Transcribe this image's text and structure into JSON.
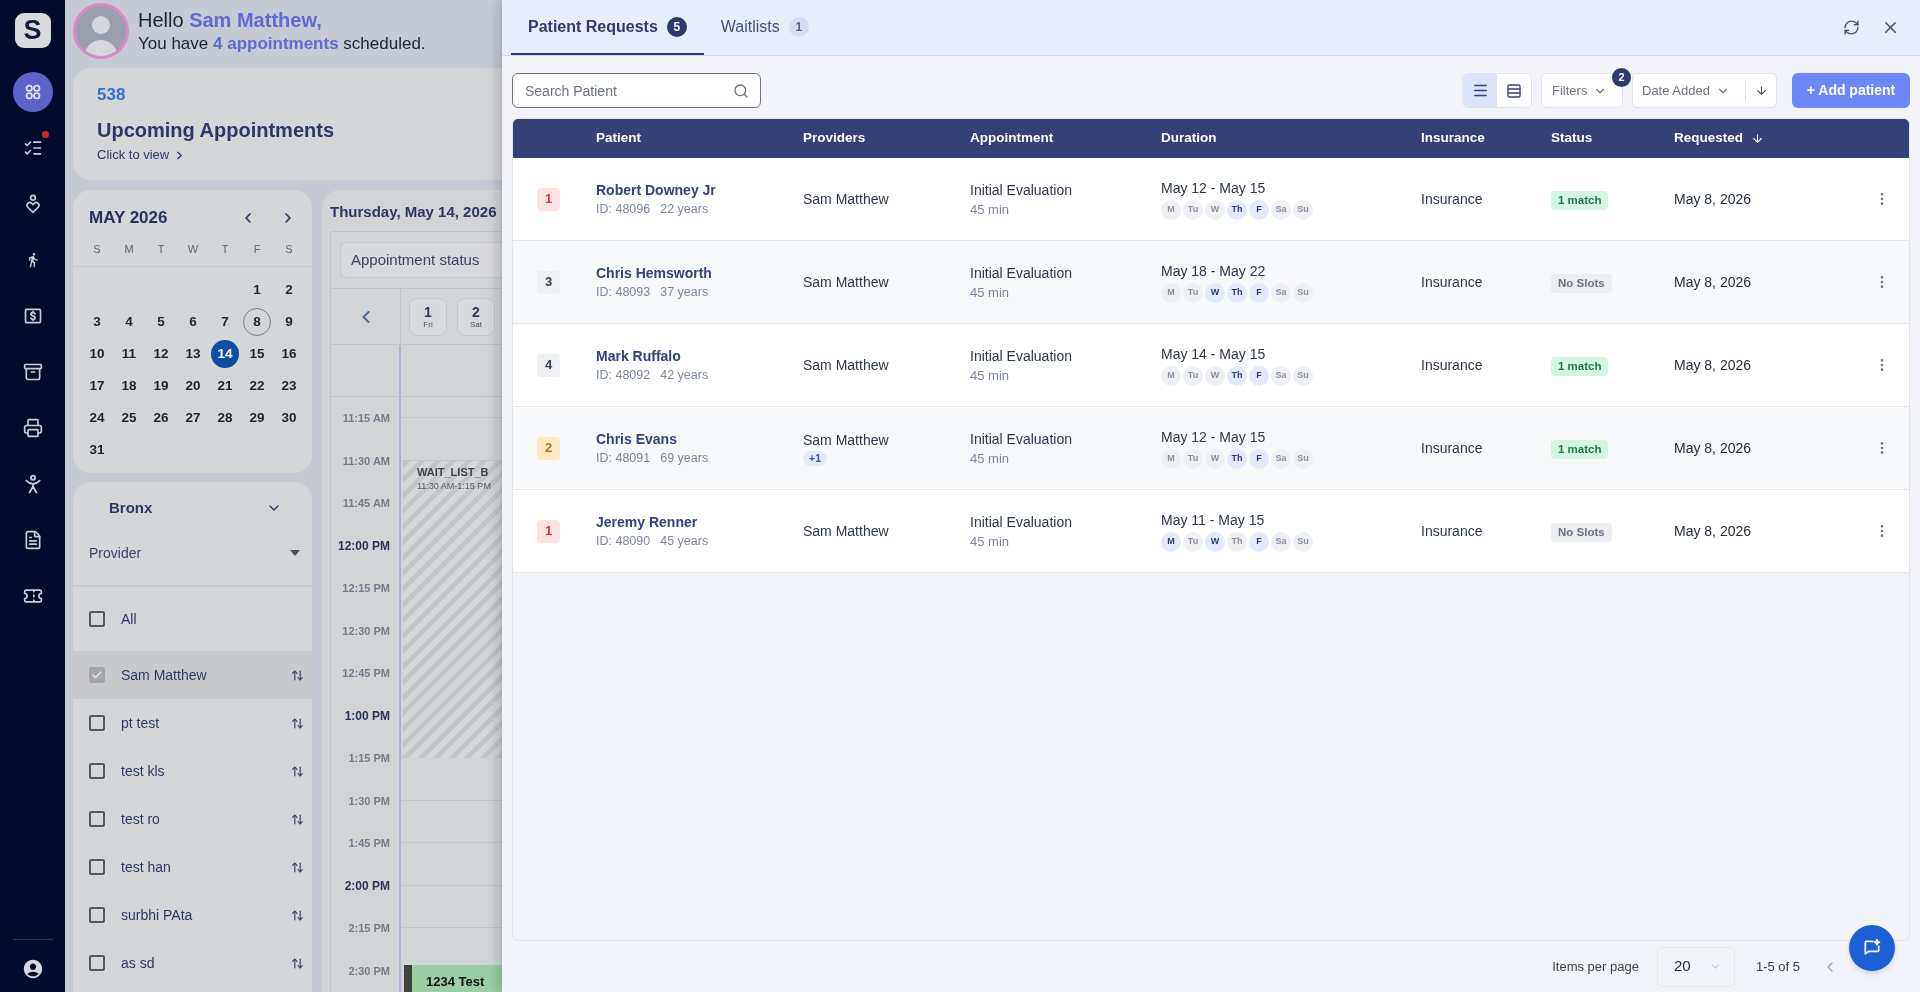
{
  "nav": {
    "logo": "S",
    "items": [
      {
        "selected": true,
        "alert": false
      },
      {
        "selected": false,
        "alert": true
      },
      {
        "selected": false,
        "alert": false
      },
      {
        "selected": false,
        "alert": false
      },
      {
        "selected": false,
        "alert": false
      },
      {
        "selected": false,
        "alert": false
      },
      {
        "selected": false,
        "alert": false
      },
      {
        "selected": false,
        "alert": false
      },
      {
        "selected": false,
        "alert": false
      },
      {
        "selected": false,
        "alert": false
      }
    ]
  },
  "greeting": {
    "line_1": "Hello **Sam Matthew,**",
    "line_2": "You have **4 appointments** scheduled."
  },
  "summary_card": {
    "count": "538",
    "title": "Upcoming Appointments",
    "link": "Click to view"
  },
  "mini_calendar": {
    "title": "MAY 2026",
    "weekdays": [
      "S",
      "M",
      "T",
      "W",
      "T",
      "F",
      "S"
    ],
    "weeks": [
      [
        {
          "label": "1",
          "selected": false,
          "today": false
        },
        {
          "label": "2",
          "selected": false,
          "today": false
        }
      ],
      [
        {
          "label": "3",
          "selected": false,
          "today": false
        },
        {
          "label": "4",
          "selected": false,
          "today": false
        },
        {
          "label": "5",
          "selected": false,
          "today": false
        },
        {
          "label": "6",
          "selected": false,
          "today": false
        },
        {
          "label": "7",
          "selected": false,
          "today": false
        },
        {
          "label": "8",
          "selected": false,
          "today": true
        },
        {
          "label": "9",
          "selected": false,
          "today": false
        }
      ],
      [
        {
          "label": "10",
          "selected": false,
          "today": false
        },
        {
          "label": "11",
          "selected": false,
          "today": false
        },
        {
          "label": "12",
          "selected": false,
          "today": false
        },
        {
          "label": "13",
          "selected": false,
          "today": false
        },
        {
          "label": "14",
          "selected": true,
          "today": false
        },
        {
          "label": "15",
          "selected": false,
          "today": false
        },
        {
          "label": "16",
          "selected": false,
          "today": false
        }
      ],
      [
        {
          "label": "17",
          "selected": false,
          "today": false
        },
        {
          "label": "18",
          "selected": false,
          "today": false
        },
        {
          "label": "19",
          "selected": false,
          "today": false
        },
        {
          "label": "20",
          "selected": false,
          "today": false
        },
        {
          "label": "21",
          "selected": false,
          "today": false
        },
        {
          "label": "22",
          "selected": false,
          "today": false
        },
        {
          "label": "23",
          "selected": false,
          "today": false
        }
      ],
      [
        {
          "label": "24",
          "selected": false,
          "today": false
        },
        {
          "label": "25",
          "selected": false,
          "today": false
        },
        {
          "label": "26",
          "selected": false,
          "today": false
        },
        {
          "label": "27",
          "selected": false,
          "today": false
        },
        {
          "label": "28",
          "selected": false,
          "today": false
        },
        {
          "label": "29",
          "selected": false,
          "today": false
        },
        {
          "label": "30",
          "selected": false,
          "today": false
        }
      ],
      [
        {
          "label": "31",
          "selected": false,
          "today": false
        }
      ]
    ]
  },
  "schedule": {
    "date_title": "Thursday, May 14, 2026",
    "status_filter": "Appointment status",
    "day_strip": [
      {
        "day": "1",
        "weekday": "Fri"
      },
      {
        "day": "2",
        "weekday": "Sat"
      }
    ],
    "times": [
      {
        "label": "11:15 AM",
        "kind": "quarter"
      },
      {
        "label": "11:30 AM",
        "kind": "quarter"
      },
      {
        "label": "11:45 AM",
        "kind": "quarter"
      },
      {
        "label": "12:00 PM",
        "kind": "hour"
      },
      {
        "label": "12:15 PM",
        "kind": "quarter"
      },
      {
        "label": "12:30 PM",
        "kind": "quarter"
      },
      {
        "label": "12:45 PM",
        "kind": "quarter"
      },
      {
        "label": "1:00 PM",
        "kind": "hour"
      },
      {
        "label": "1:15 PM",
        "kind": "quarter"
      },
      {
        "label": "1:30 PM",
        "kind": "quarter"
      },
      {
        "label": "1:45 PM",
        "kind": "quarter"
      },
      {
        "label": "2:00 PM",
        "kind": "hour"
      },
      {
        "label": "2:15 PM",
        "kind": "quarter"
      },
      {
        "label": "2:30 PM",
        "kind": "quarter"
      }
    ],
    "events": [
      {
        "kind": "blocked",
        "title": "WAIT_LIST_B",
        "time": "11:30 AM-1:15 PM"
      },
      {
        "kind": "appointment",
        "title": "1234 Test"
      }
    ]
  },
  "providers": {
    "location": "Bronx",
    "filter": "Provider",
    "items": [
      {
        "kind": "all",
        "name": "All",
        "checked": false,
        "selected": false
      },
      {
        "kind": "provider",
        "name": "Sam Matthew",
        "checked": true,
        "selected": true
      },
      {
        "kind": "provider",
        "name": "pt test",
        "checked": false,
        "selected": false
      },
      {
        "kind": "provider",
        "name": "test kls",
        "checked": false,
        "selected": false
      },
      {
        "kind": "provider",
        "name": "test ro",
        "checked": false,
        "selected": false
      },
      {
        "kind": "provider",
        "name": "test han",
        "checked": false,
        "selected": false
      },
      {
        "kind": "provider",
        "name": "surbhi PAta",
        "checked": false,
        "selected": false
      },
      {
        "kind": "provider",
        "name": "as sd",
        "checked": false,
        "selected": false
      }
    ]
  },
  "panel": {
    "tabs": [
      {
        "label": "Patient Requests",
        "count": "5",
        "selected": true
      },
      {
        "label": "Waitlists",
        "count": "1",
        "selected": false
      }
    ],
    "search": {
      "placeholder": "Search Patient"
    },
    "view_modes": [
      {
        "selected": true
      },
      {
        "selected": false
      }
    ],
    "filters": {
      "label": "Filters",
      "count": "2"
    },
    "sort": {
      "label": "Date Added"
    },
    "add_button": "+ Add patient",
    "table": {
      "columns": [
        {
          "label": "Patient",
          "sorted": false
        },
        {
          "label": "Providers",
          "sorted": false
        },
        {
          "label": "Appointment",
          "sorted": false
        },
        {
          "label": "Duration",
          "sorted": false
        },
        {
          "label": "Insurance",
          "sorted": false
        },
        {
          "label": "Status",
          "sorted": false
        },
        {
          "label": "Requested",
          "sorted": true
        }
      ],
      "rows": [
        {
          "priority": {
            "label": "1",
            "color": "#fde2e2"
          },
          "name": "Robert Downey Jr",
          "id": "ID: 48096",
          "age": "22 years",
          "provider": "Sam Matthew",
          "appointment": "Initial Evaluation",
          "length": "45 min",
          "range": "May 12 - May 15",
          "days": [
            {
              "label": "M",
              "selected": false
            },
            {
              "label": "Tu",
              "selected": false
            },
            {
              "label": "W",
              "selected": false
            },
            {
              "label": "Th",
              "selected": true
            },
            {
              "label": "F",
              "selected": true
            },
            {
              "label": "Sa",
              "selected": false
            },
            {
              "label": "Su",
              "selected": false
            }
          ],
          "insurance": "Insurance",
          "status": {
            "label": "1 match",
            "color": "#d5f5e3"
          },
          "requested": "May 8, 2026"
        },
        {
          "priority": {
            "label": "3",
            "color": "#eef0f4"
          },
          "name": "Chris Hemsworth",
          "id": "ID: 48093",
          "age": "37 years",
          "provider": "Sam Matthew",
          "appointment": "Initial Evaluation",
          "length": "45 min",
          "range": "May 18 - May 22",
          "days": [
            {
              "label": "M",
              "selected": false
            },
            {
              "label": "Tu",
              "selected": false
            },
            {
              "label": "W",
              "selected": true
            },
            {
              "label": "Th",
              "selected": true
            },
            {
              "label": "F",
              "selected": true
            },
            {
              "label": "Sa",
              "selected": false
            },
            {
              "label": "Su",
              "selected": false
            }
          ],
          "insurance": "Insurance",
          "status": {
            "label": "No Slots",
            "color": "#eceef2"
          },
          "requested": "May 8, 2026"
        },
        {
          "priority": {
            "label": "4",
            "color": "#eef0f4"
          },
          "name": "Mark Ruffalo",
          "id": "ID: 48092",
          "age": "42 years",
          "provider": "Sam Matthew",
          "appointment": "Initial Evaluation",
          "length": "45 min",
          "range": "May 14 - May 15",
          "days": [
            {
              "label": "M",
              "selected": false
            },
            {
              "label": "Tu",
              "selected": false
            },
            {
              "label": "W",
              "selected": false
            },
            {
              "label": "Th",
              "selected": true
            },
            {
              "label": "F",
              "selected": true
            },
            {
              "label": "Sa",
              "selected": false
            },
            {
              "label": "Su",
              "selected": false
            }
          ],
          "insurance": "Insurance",
          "status": {
            "label": "1 match",
            "color": "#d5f5e3"
          },
          "requested": "May 8, 2026"
        },
        {
          "priority": {
            "label": "2",
            "color": "#fde9c6"
          },
          "name": "Chris Evans",
          "id": "ID: 48091",
          "age": "69 years",
          "provider": "Sam Matthew",
          "extra_providers": "+1",
          "appointment": "Initial Evaluation",
          "length": "45 min",
          "range": "May 12 - May 15",
          "days": [
            {
              "label": "M",
              "selected": false
            },
            {
              "label": "Tu",
              "selected": false
            },
            {
              "label": "W",
              "selected": false
            },
            {
              "label": "Th",
              "selected": true
            },
            {
              "label": "F",
              "selected": true
            },
            {
              "label": "Sa",
              "selected": false
            },
            {
              "label": "Su",
              "selected": false
            }
          ],
          "insurance": "Insurance",
          "status": {
            "label": "1 match",
            "color": "#d5f5e3"
          },
          "requested": "May 8, 2026"
        },
        {
          "priority": {
            "label": "1",
            "color": "#fde2e2"
          },
          "name": "Jeremy Renner",
          "id": "ID: 48090",
          "age": "45 years",
          "provider": "Sam Matthew",
          "appointment": "Initial Evaluation",
          "length": "45 min",
          "range": "May 11 - May 15",
          "days": [
            {
              "label": "M",
              "selected": true
            },
            {
              "label": "Tu",
              "selected": false
            },
            {
              "label": "W",
              "selected": true
            },
            {
              "label": "Th",
              "selected": false
            },
            {
              "label": "F",
              "selected": true
            },
            {
              "label": "Sa",
              "selected": false
            },
            {
              "label": "Su",
              "selected": false
            }
          ],
          "insurance": "Insurance",
          "status": {
            "label": "No Slots",
            "color": "#eceef2"
          },
          "requested": "May 8, 2026"
        }
      ]
    },
    "pagination": {
      "label": "Items per page",
      "page_size": "20",
      "range": "1-5 of 5"
    }
  }
}
